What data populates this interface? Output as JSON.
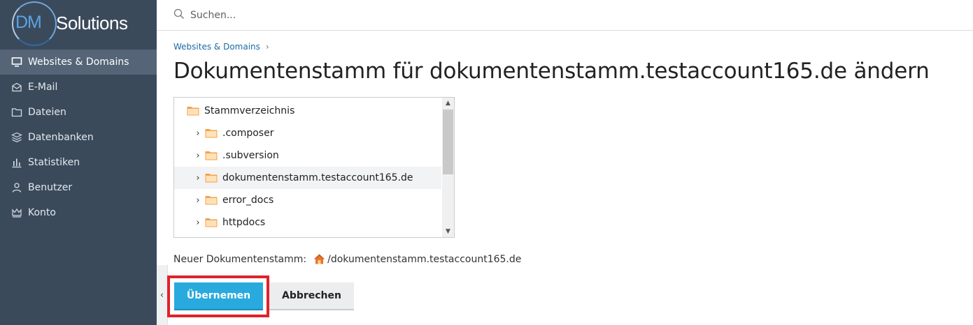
{
  "brand": {
    "logo_prefix": "DM",
    "logo_suffix": "Solutions"
  },
  "sidebar": {
    "items": [
      {
        "label": "Websites & Domains",
        "icon": "monitor-icon",
        "active": true
      },
      {
        "label": "E-Mail",
        "icon": "envelope-icon"
      },
      {
        "label": "Dateien",
        "icon": "folder-icon"
      },
      {
        "label": "Datenbanken",
        "icon": "database-layers-icon"
      },
      {
        "label": "Statistiken",
        "icon": "bar-chart-icon"
      },
      {
        "label": "Benutzer",
        "icon": "user-icon"
      },
      {
        "label": "Konto",
        "icon": "crown-icon"
      }
    ]
  },
  "search": {
    "placeholder": "Suchen..."
  },
  "breadcrumb": {
    "item": "Websites & Domains"
  },
  "page": {
    "title": "Dokumentenstamm für dokumentenstamm.testaccount165.de ändern"
  },
  "tree": {
    "root": "Stammverzeichnis",
    "items": [
      {
        "label": ".composer"
      },
      {
        "label": ".subversion"
      },
      {
        "label": "dokumentenstamm.testaccount165.de",
        "selected": true
      },
      {
        "label": "error_docs"
      },
      {
        "label": "httpdocs"
      }
    ]
  },
  "new_root": {
    "label": "Neuer Dokumentenstamm:",
    "path": "/dokumentenstamm.testaccount165.de"
  },
  "buttons": {
    "apply": "Übernemen",
    "cancel": "Abbrechen"
  },
  "colors": {
    "sidebar": "#3b4a5b",
    "sidebar_active": "#556577",
    "primary": "#28aade",
    "folder": "#f5a14d",
    "highlight": "#e1212a",
    "link": "#1b6aa5"
  }
}
